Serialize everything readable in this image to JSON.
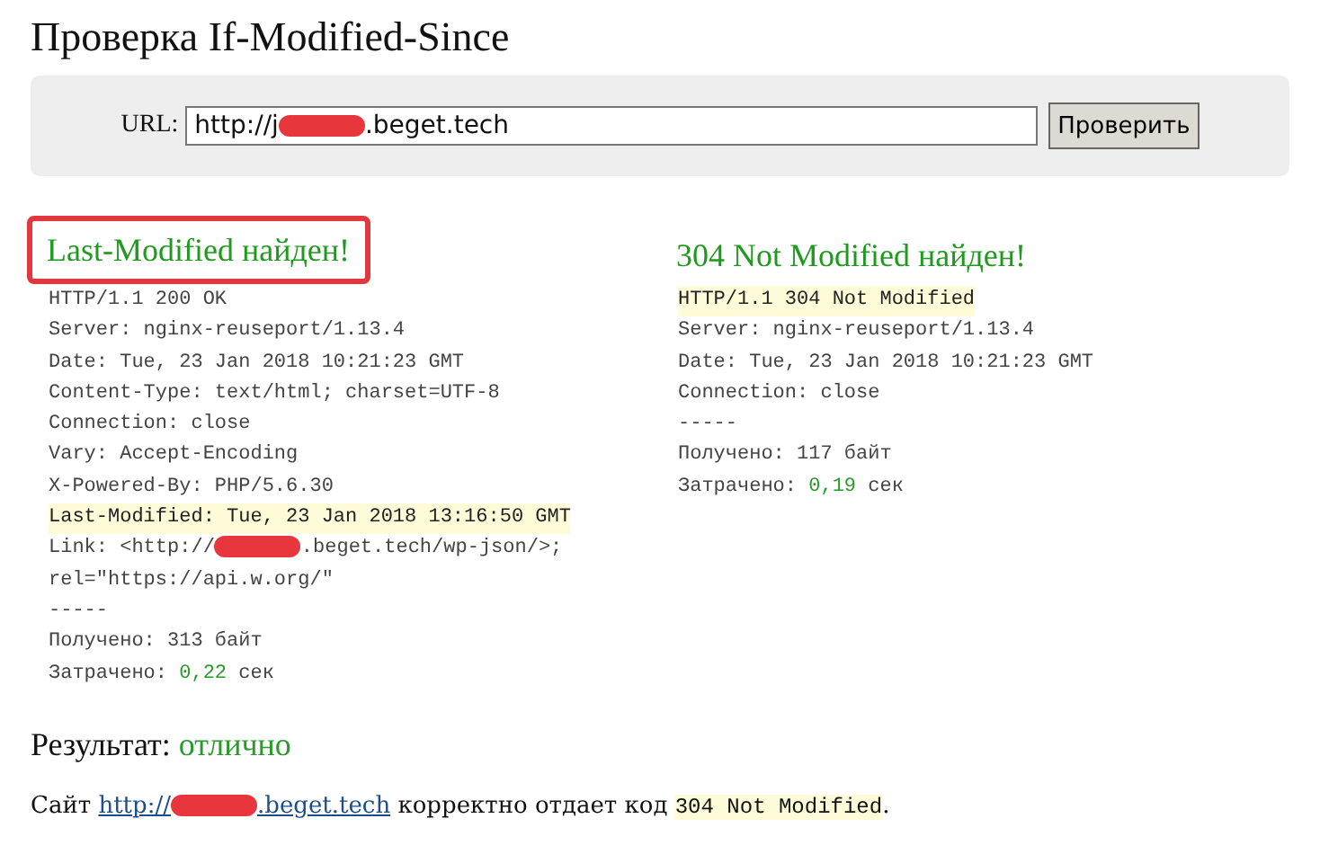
{
  "title": "Проверка If-Modified-Since",
  "form": {
    "label": "URL:",
    "url_before": "http://j",
    "url_after": ".beget.tech",
    "button": "Проверить"
  },
  "columns": [
    {
      "heading": "Last-Modified найден!",
      "outlined": true,
      "lines": [
        {
          "kind": "plain",
          "text": "HTTP/1.1 200 OK"
        },
        {
          "kind": "plain",
          "text": "Server: nginx-reuseport/1.13.4"
        },
        {
          "kind": "plain",
          "text": "Date: Tue, 23 Jan 2018 10:21:23 GMT"
        },
        {
          "kind": "plain",
          "text": "Content-Type: text/html; charset=UTF-8"
        },
        {
          "kind": "plain",
          "text": "Connection: close"
        },
        {
          "kind": "plain",
          "text": "Vary: Accept-Encoding"
        },
        {
          "kind": "plain",
          "text": "X-Powered-By: PHP/5.6.30"
        },
        {
          "kind": "highlight",
          "text": "Last-Modified: Tue, 23 Jan 2018 13:16:50 GMT"
        },
        {
          "kind": "redacted",
          "before": "Link: <http://",
          "after": ".beget.tech/wp-json/>;"
        },
        {
          "kind": "plain",
          "text": "rel=\"https://api.w.org/\""
        },
        {
          "kind": "plain",
          "text": "-----"
        },
        {
          "kind": "plain",
          "text": "Получено:  313 байт"
        },
        {
          "kind": "timing",
          "label": "Затрачено:",
          "value": "0,22",
          "unit": "сек"
        }
      ]
    },
    {
      "heading": "304 Not Modified найден!",
      "outlined": false,
      "lines": [
        {
          "kind": "highlight",
          "text": "HTTP/1.1 304 Not Modified"
        },
        {
          "kind": "plain",
          "text": "Server: nginx-reuseport/1.13.4"
        },
        {
          "kind": "plain",
          "text": "Date: Tue, 23 Jan 2018 10:21:23 GMT"
        },
        {
          "kind": "plain",
          "text": "Connection: close"
        },
        {
          "kind": "plain",
          "text": "-----"
        },
        {
          "kind": "plain",
          "text": "Получено:  117 байт"
        },
        {
          "kind": "timing",
          "label": "Затрачено:",
          "value": "0,19",
          "unit": "сек"
        }
      ]
    }
  ],
  "result": {
    "label": "Результат:",
    "value": "отлично"
  },
  "summary": {
    "before": "Сайт",
    "link_before": "http://",
    "link_after": ".beget.tech",
    "middle": "корректно отдает код",
    "code": "304 Not Modified",
    "end": "."
  }
}
